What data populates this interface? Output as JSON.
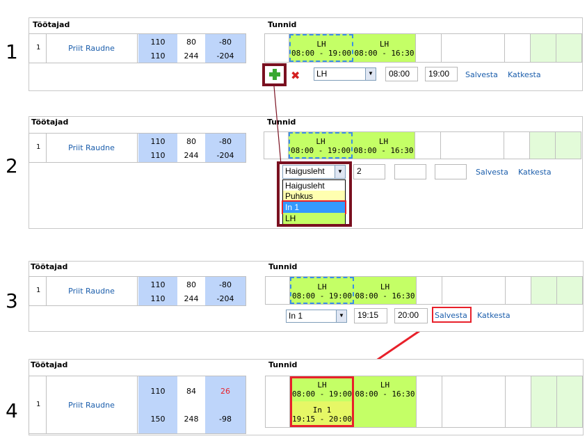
{
  "steps": [
    "1",
    "2",
    "3",
    "4"
  ],
  "headers": {
    "employees": "Töötajad",
    "hours": "Tunnid"
  },
  "employee": {
    "index": "1",
    "name": "Priit Raudne",
    "col_a": [
      "110",
      "110"
    ],
    "col_b": [
      "80",
      "244"
    ],
    "col_c": [
      "-80",
      "-204"
    ]
  },
  "employee_after": {
    "col_a": [
      "110",
      "150"
    ],
    "col_b": [
      "84",
      "248"
    ],
    "col_c": [
      "26",
      "-98"
    ],
    "highlight_color": "#e8202a"
  },
  "shifts": [
    {
      "type": "LH",
      "time": "08:00 - 19:00"
    },
    {
      "type": "LH",
      "time": "08:00 - 16:30"
    }
  ],
  "new_shift": {
    "type": "In 1",
    "time": "19:15 - 20:00"
  },
  "editor1": {
    "select_value": "LH",
    "start": "08:00",
    "end": "19:00"
  },
  "editor2": {
    "select_value": "Haigusleht",
    "amount": "2"
  },
  "editor3": {
    "select_value": "In 1",
    "start": "19:15",
    "end": "20:00"
  },
  "dropdown_options": [
    "Haigusleht",
    "Puhkus",
    "In 1",
    "LH"
  ],
  "actions": {
    "save": "Salvesta",
    "cancel": "Katkesta"
  },
  "icons": {
    "add": "plus-icon",
    "delete": "delete-x-icon",
    "dropdown": "chevron-down-icon"
  },
  "colors": {
    "shift_green": "#c4ff66",
    "shift_yellow": "#e6f766",
    "stat_blue": "#bed5fa",
    "empty_green": "#e3fbd9",
    "annotation_red": "#e8202a",
    "annotation_dark": "#7a1020",
    "link_blue": "#1a5dab"
  }
}
